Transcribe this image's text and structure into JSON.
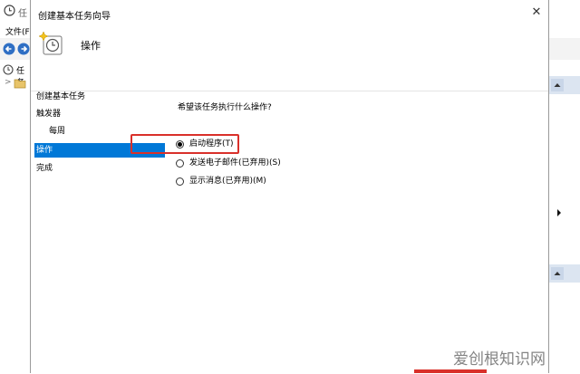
{
  "background_window": {
    "title_fragment": "任",
    "menu_fragment": "文件(F",
    "tree_fragment": "任务",
    "tree_expand": ">"
  },
  "dialog": {
    "title": "创建基本任务向导",
    "close_glyph": "✕",
    "header_title": "操作",
    "nav": [
      {
        "label": "创建基本任务",
        "selected": false,
        "indent": 0
      },
      {
        "label": "触发器",
        "selected": false,
        "indent": 0
      },
      {
        "label": "每周",
        "selected": false,
        "indent": 1
      },
      {
        "label": "操作",
        "selected": true,
        "indent": 0
      },
      {
        "label": "完成",
        "selected": false,
        "indent": 0
      }
    ],
    "question": "希望该任务执行什么操作?",
    "options": [
      {
        "label": "启动程序(T)",
        "selected": true
      },
      {
        "label": "发送电子邮件(已弃用)(S)",
        "selected": false
      },
      {
        "label": "显示消息(已弃用)(M)",
        "selected": false
      }
    ]
  },
  "watermark": "爱创根知识网",
  "colors": {
    "selection": "#0078d7",
    "highlight": "#d9302a",
    "right_panel_band": "#dce5f1"
  },
  "icons": [
    "clock-icon",
    "back-arrow-icon",
    "forward-arrow-icon",
    "folder-icon",
    "task-wizard-icon",
    "close-icon",
    "scroll-up-icon",
    "expand-arrow-icon"
  ]
}
